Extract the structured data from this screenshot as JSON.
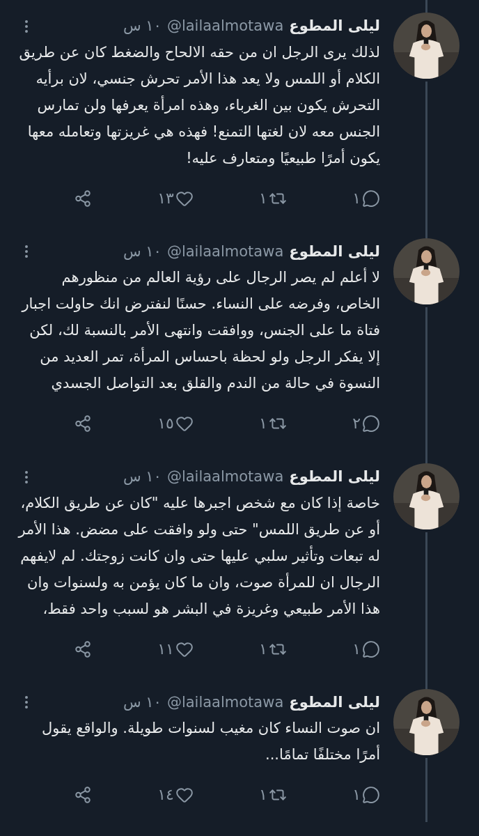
{
  "tweets": [
    {
      "name": "ليلى المطوع",
      "handle": "@lailaalmotawa",
      "time": "١٠ س",
      "text": "لذلك يرى الرجل ان من حقه الالحاح والضغط كان عن طريق الكلام أو اللمس ولا يعد هذا الأمر تحرش جنسي، لان برأيه التحرش يكون بين الغرباء، وهذه امرأة يعرفها ولن تمارس الجنس معه لان لغتها التمنع! فهذه هي غريزتها وتعامله معها يكون أمرًا طبيعيًا ومتعارف عليه!",
      "replies": "١",
      "retweets": "١",
      "likes": "١٣"
    },
    {
      "name": "ليلى المطوع",
      "handle": "@lailaalmotawa",
      "time": "١٠ س",
      "text": "لا أعلم لم يصر الرجال على رؤية العالم من منظورهم الخاص، وفرضه على النساء. حسنًا لنفترض انك حاولت اجبار فتاة ما على الجنس، ووافقت وانتهى الأمر بالنسبة لك، لكن إلا يفكر الرجل ولو لحظة باحساس المرأة، تمر العديد من النسوة في حالة من الندم والقلق بعد التواصل الجسدي",
      "replies": "٢",
      "retweets": "١",
      "likes": "١٥"
    },
    {
      "name": "ليلى المطوع",
      "handle": "@lailaalmotawa",
      "time": "١٠ س",
      "text": "خاصة إذا كان مع شخص اجبرها عليه \"كان عن طريق الكلام، أو عن طريق اللمس\" حتى ولو وافقت على مضض. هذا الأمر له تبعات وتأثير سلبي عليها حتى وان كانت زوجتك. لم لايفهم الرجال ان للمرأة صوت، وان ما كان يؤمن به ولسنوات وان هذا الأمر طبيعي وغريزة في البشر هو لسبب واحد فقط،",
      "replies": "١",
      "retweets": "١",
      "likes": "١١"
    },
    {
      "name": "ليلى المطوع",
      "handle": "@lailaalmotawa",
      "time": "١٠ س",
      "text": "ان صوت النساء كان مغيب لسنوات طويلة. والواقع يقول أمرًا مختلفًا تمامًا...",
      "replies": "١",
      "retweets": "١",
      "likes": "١٤"
    }
  ]
}
